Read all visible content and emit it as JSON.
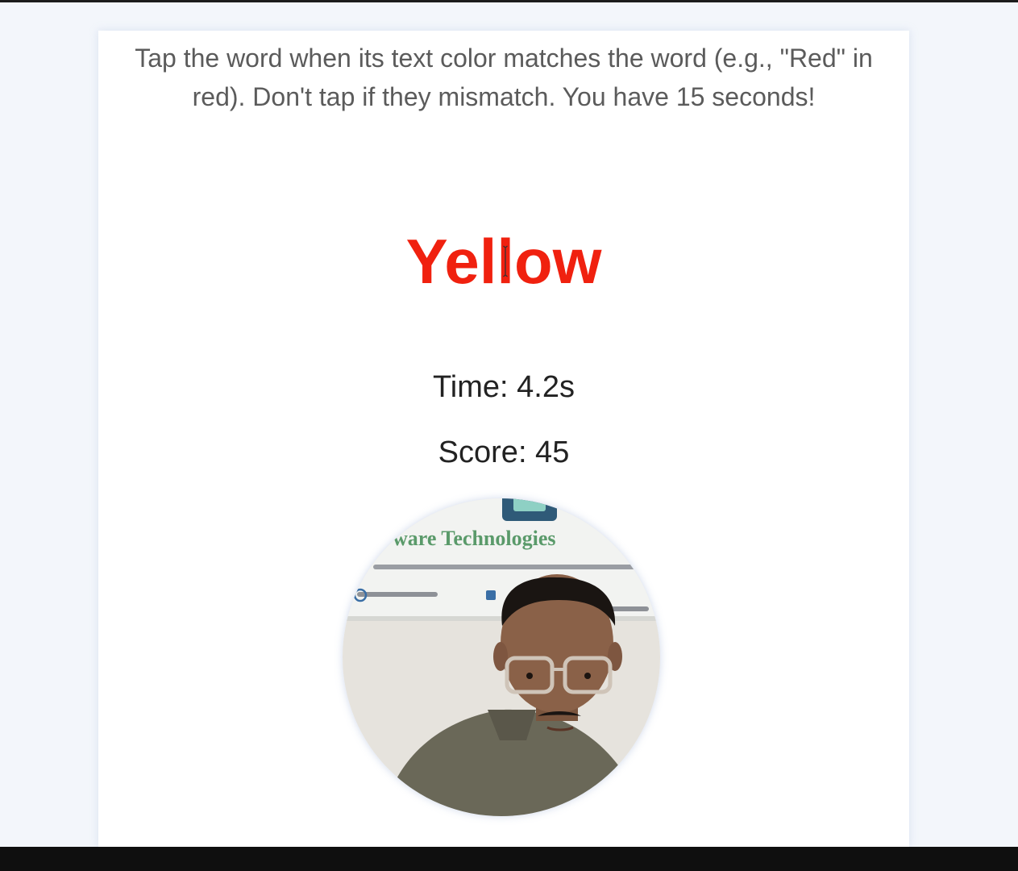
{
  "game": {
    "instructions": "Tap the word when its text color matches the word (e.g., \"Red\" in red). Don't tap if they mismatch. You have 15 seconds!",
    "word": "Yellow",
    "word_color": "#f0210f",
    "time_text": "Time: 4.2s",
    "score_text": "Score: 45"
  },
  "webcam": {
    "banner_text": "ware Technologies"
  },
  "colors": {
    "page_background": "#f3f6fb",
    "card_background": "#ffffff",
    "instruction_text": "#5b5b5b",
    "stat_text": "#222222",
    "bottom_bar": "#0f0f0f"
  }
}
